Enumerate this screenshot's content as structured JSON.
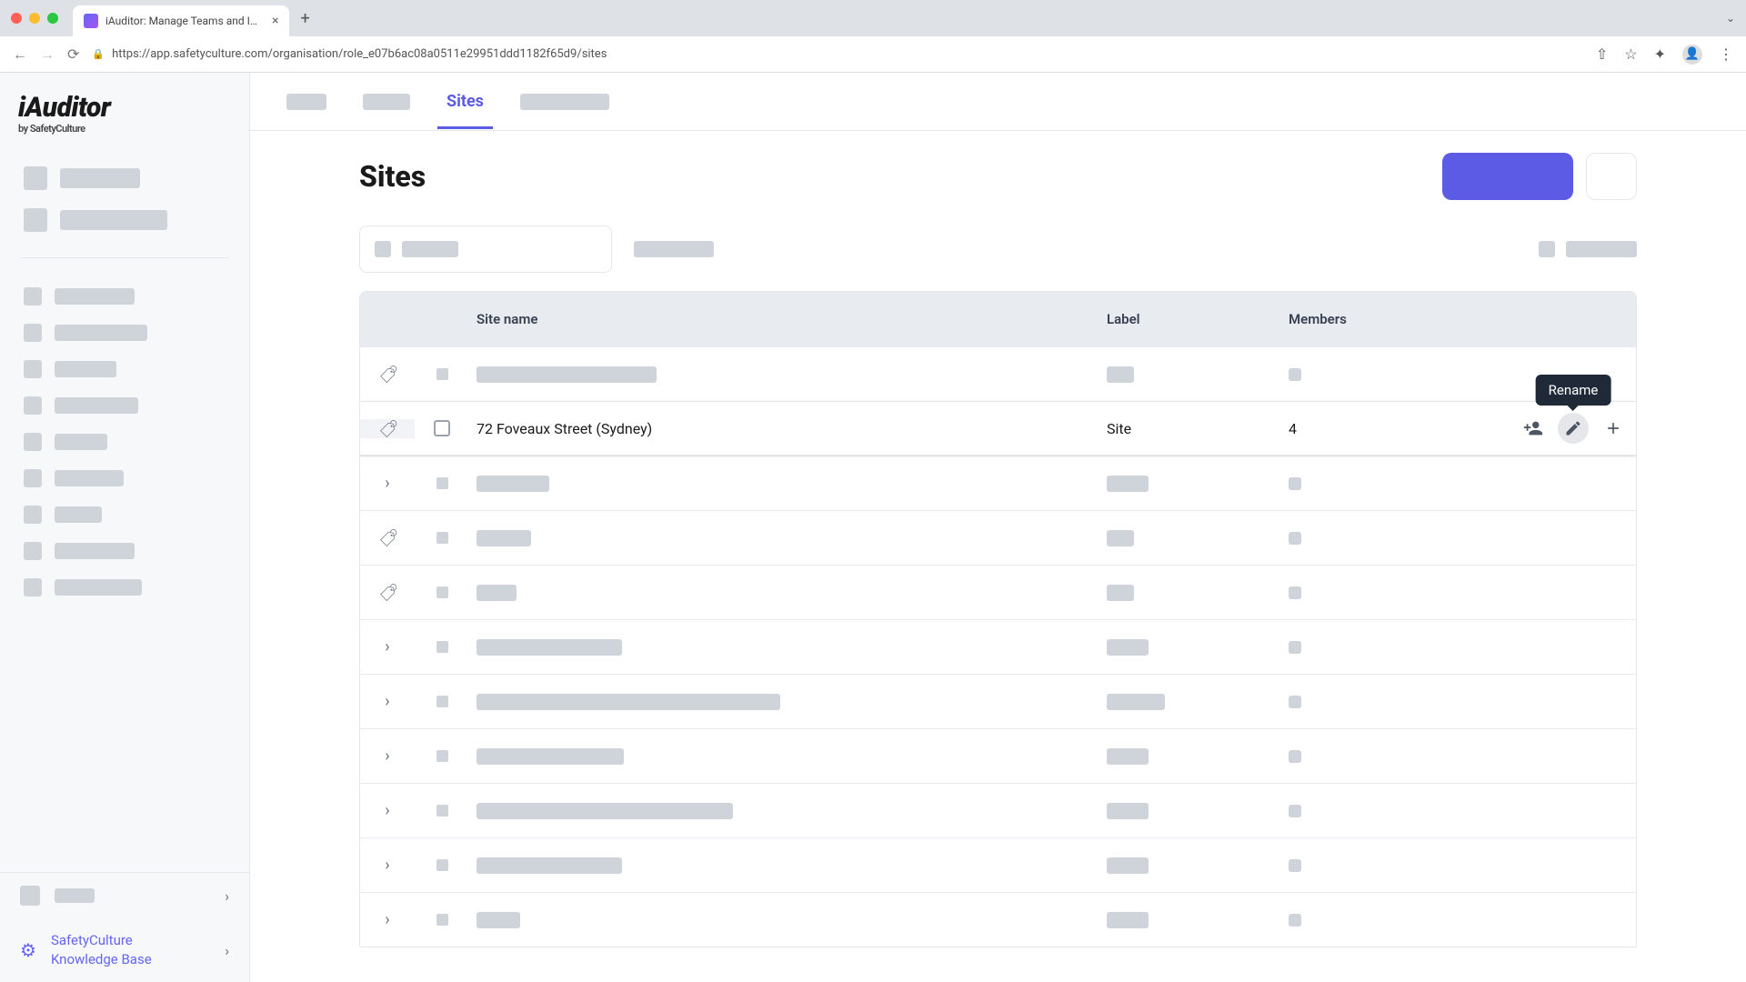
{
  "browser": {
    "tab_title": "iAuditor: Manage Teams and I…",
    "url": "https://app.safetyculture.com/organisation/role_e07b6ac08a0511e29951ddd1182f65d9/sites"
  },
  "logo": {
    "brand": "iAuditor",
    "byline": "by SafetyCulture"
  },
  "sidebar": {
    "kb_line1": "SafetyCulture",
    "kb_line2": "Knowledge Base"
  },
  "topbar": {
    "tabs": {
      "active": "Sites"
    }
  },
  "page": {
    "title": "Sites"
  },
  "table": {
    "headers": {
      "name": "Site name",
      "label": "Label",
      "members": "Members"
    },
    "hovered_row": {
      "name": "72 Foveaux Street (Sydney)",
      "label": "Site",
      "members": "4"
    },
    "tooltip": "Rename"
  }
}
